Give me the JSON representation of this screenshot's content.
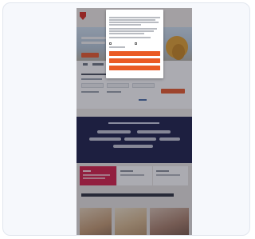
{
  "site": {
    "logo_text": "",
    "colors": {
      "brand_red": "#d92b1e",
      "accent_orange": "#ea5a24",
      "navy": "#1a1d4a",
      "crimson": "#d71e47"
    }
  },
  "cookie_dialog": {
    "title": "",
    "checkbox_labels": [
      "",
      ""
    ],
    "accept_all_label": "",
    "accept_selected_label": "",
    "reject_label": "",
    "settings_link": ""
  },
  "page": {
    "section_heading": ""
  }
}
